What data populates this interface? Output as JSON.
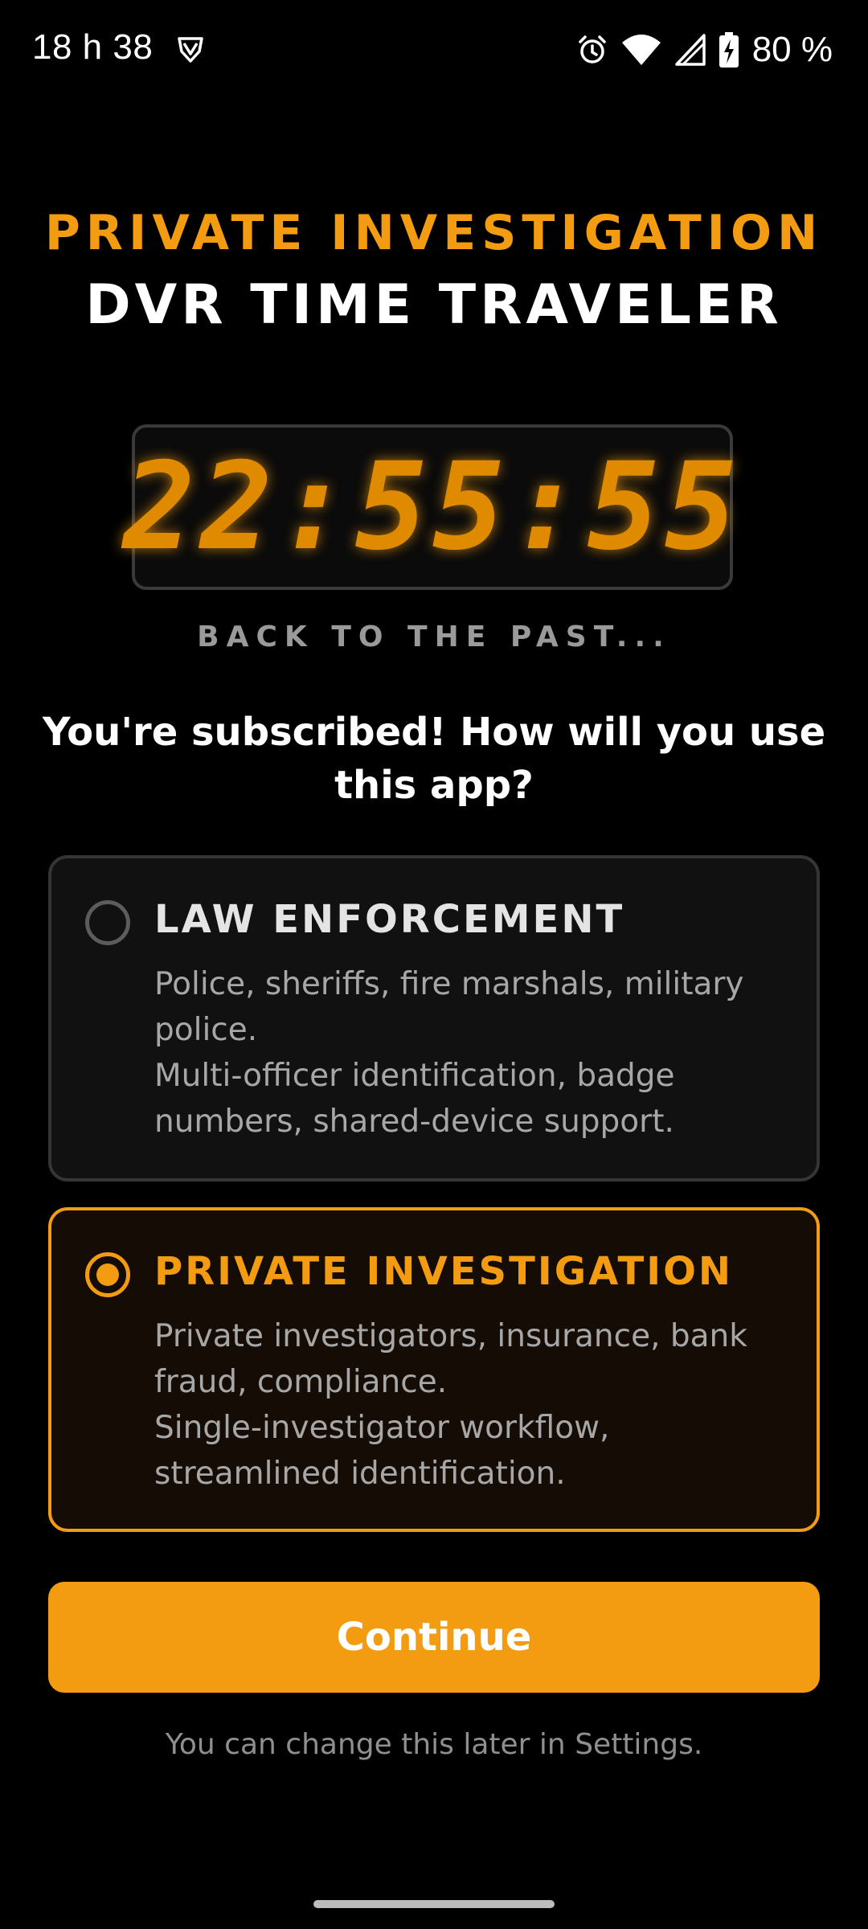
{
  "status_bar": {
    "time": "18 h 38",
    "battery": "80 %",
    "icons": [
      "vpn-shield-icon",
      "alarm-icon",
      "wifi-icon",
      "cell-signal-icon",
      "battery-charging-icon"
    ]
  },
  "header": {
    "title_top": "PRIVATE INVESTIGATION",
    "title_bottom": "DVR TIME TRAVELER"
  },
  "clock": {
    "display": "22:55:55",
    "tagline": "BACK TO THE PAST..."
  },
  "question": "You're subscribed! How will you use this app?",
  "options": [
    {
      "title": "LAW ENFORCEMENT",
      "line1": "Police, sheriffs, fire marshals, military police.",
      "line2": "Multi-officer identification, badge numbers, shared-device support.",
      "selected": false
    },
    {
      "title": "PRIVATE INVESTIGATION",
      "line1": "Private investigators, insurance, bank fraud, compliance.",
      "line2": "Single-investigator workflow, streamlined identification.",
      "selected": true
    }
  ],
  "continue_label": "Continue",
  "footer_note": "You can change this later in Settings.",
  "colors": {
    "accent": "#f39c12",
    "background": "#000000",
    "card_bg": "#111111",
    "card_selected_bg": "#140c05"
  }
}
